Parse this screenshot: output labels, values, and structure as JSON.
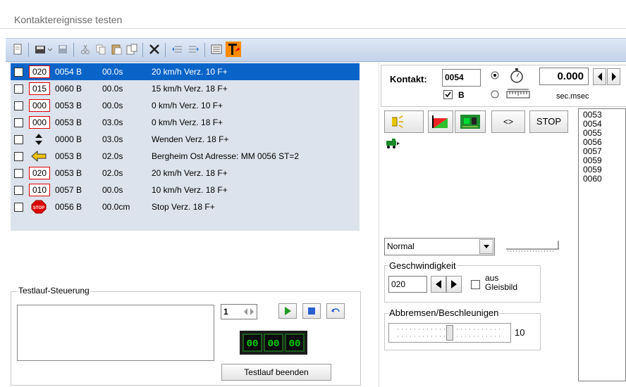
{
  "window": {
    "title": "Kontaktereignisse testen"
  },
  "toolbar": {
    "icons": [
      "new-page-icon",
      "save-icon",
      "save-as-icon",
      "cut-icon",
      "copy-icon",
      "paste-icon",
      "paste-special-icon",
      "delete-icon",
      "insert-before-icon",
      "insert-after-icon",
      "list-icon",
      "tc-logo-icon"
    ]
  },
  "events": [
    {
      "badge": "020",
      "addr": "0054 B",
      "time": "00.0s",
      "desc": "20 km/h Verz. 10 F+",
      "selected": true,
      "icon": "speed"
    },
    {
      "badge": "015",
      "addr": "0060 B",
      "time": "00.0s",
      "desc": "15 km/h Verz. 18 F+",
      "icon": "speed"
    },
    {
      "badge": "000",
      "addr": "0053 B",
      "time": "00.0s",
      "desc": "0 km/h Verz. 10 F+",
      "icon": "speed"
    },
    {
      "badge": "000",
      "addr": "0053 B",
      "time": "03.0s",
      "desc": "0 km/h Verz. 18 F+",
      "icon": "speed"
    },
    {
      "badge": "",
      "addr": "0000 B",
      "time": "03.0s",
      "desc": "Wenden Verz. 18 F+",
      "icon": "reverse"
    },
    {
      "badge": "",
      "addr": "0053 B",
      "time": "02.0s",
      "desc": "Bergheim Ost Adresse: MM 0056 ST=2",
      "icon": "turnout"
    },
    {
      "badge": "020",
      "addr": "0053 B",
      "time": "02.0s",
      "desc": "20 km/h Verz. 18 F+",
      "icon": "speed"
    },
    {
      "badge": "010",
      "addr": "0057 B",
      "time": "00.0s",
      "desc": "10 km/h Verz. 18 F+",
      "icon": "speed"
    },
    {
      "badge": "STOP",
      "addr": "0056 B",
      "time": "00.0cm",
      "desc": "Stop Verz. 18 F+",
      "icon": "stop"
    }
  ],
  "testlauf": {
    "group_label": "Testlauf-Steuerung",
    "counter": "1",
    "lcd": [
      "00",
      "00",
      "00"
    ],
    "end_button": "Testlauf beenden"
  },
  "kontakt": {
    "label": "Kontakt:",
    "value": "0054",
    "b_label": "B",
    "b_checked": true,
    "time_value": "0.000",
    "time_unit": "sec.msec"
  },
  "buttons": {
    "nav": "<>",
    "stop": "STOP"
  },
  "contacts_list": [
    "0053",
    "0054",
    "0055",
    "0056",
    "0057",
    "0059",
    "0059",
    "0060"
  ],
  "mode_select": {
    "value": "Normal"
  },
  "speed": {
    "group_label": "Geschwindigkeit",
    "value": "020",
    "checkbox_label_1": "aus",
    "checkbox_label_2": "Gleisbild"
  },
  "brake": {
    "group_label": "Abbremsen/Beschleunigen",
    "value": "10",
    "slider_position": 0.5
  },
  "colors": {
    "selection": "#0a64c8",
    "badge_border": "#dd0000",
    "lcd_text": "#00d000",
    "list_background": "#dde3ec"
  }
}
